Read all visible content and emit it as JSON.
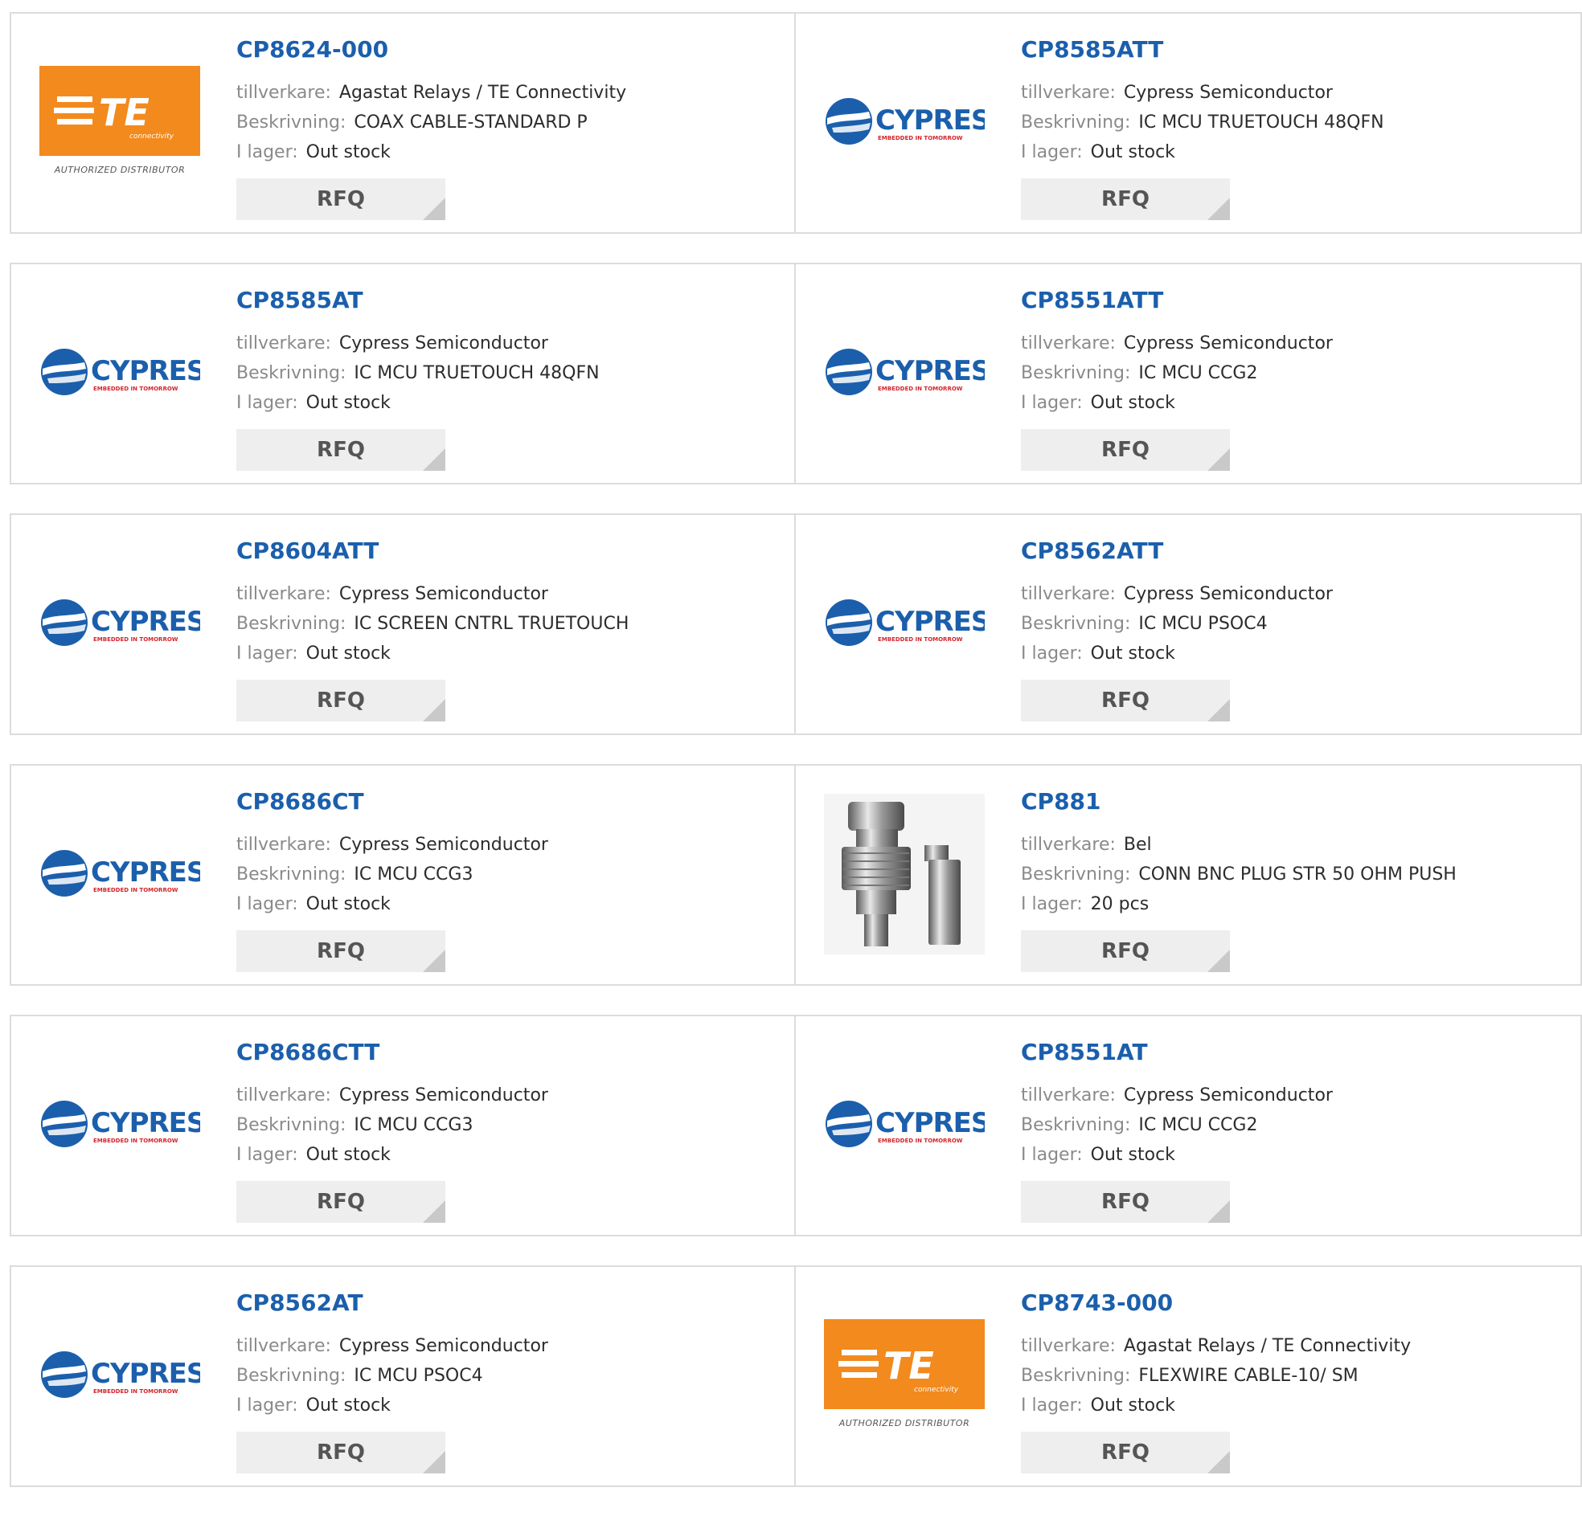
{
  "labels": {
    "manufacturer": "tillverkare:",
    "description": "Beskrivning:",
    "stock": "I lager:",
    "rfq": "RFQ"
  },
  "logos": {
    "te_letters": "TE",
    "te_sub": "connectivity",
    "te_distributor": "AUTHORIZED DISTRIBUTOR",
    "cypress_name": "CYPRESS",
    "cypress_tagline": "EMBEDDED IN TOMORROW"
  },
  "colors": {
    "part_link": "#1b5fac",
    "te_orange": "#f28a1e",
    "cypress_blue": "#1b5fac",
    "cypress_red": "#d4252b"
  },
  "products": [
    {
      "part": "CP8624-000",
      "manufacturer": "Agastat Relays / TE Connectivity",
      "description": "COAX CABLE-STANDARD P",
      "stock": "Out stock",
      "logo": "te-logo"
    },
    {
      "part": "CP8585ATT",
      "manufacturer": "Cypress Semiconductor",
      "description": "IC MCU TRUETOUCH 48QFN",
      "stock": "Out stock",
      "logo": "cypress-logo"
    },
    {
      "part": "CP8585AT",
      "manufacturer": "Cypress Semiconductor",
      "description": "IC MCU TRUETOUCH 48QFN",
      "stock": "Out stock",
      "logo": "cypress-logo"
    },
    {
      "part": "CP8551ATT",
      "manufacturer": "Cypress Semiconductor",
      "description": "IC MCU CCG2",
      "stock": "Out stock",
      "logo": "cypress-logo"
    },
    {
      "part": "CP8604ATT",
      "manufacturer": "Cypress Semiconductor",
      "description": "IC SCREEN CNTRL TRUETOUCH",
      "stock": "Out stock",
      "logo": "cypress-logo"
    },
    {
      "part": "CP8562ATT",
      "manufacturer": "Cypress Semiconductor",
      "description": "IC MCU PSOC4",
      "stock": "Out stock",
      "logo": "cypress-logo"
    },
    {
      "part": "CP8686CT",
      "manufacturer": "Cypress Semiconductor",
      "description": "IC MCU CCG3",
      "stock": "Out stock",
      "logo": "cypress-logo"
    },
    {
      "part": "CP881",
      "manufacturer": "Bel",
      "description": "CONN BNC PLUG STR 50 OHM PUSH",
      "stock": "20 pcs",
      "logo": "bnc-connector-image"
    },
    {
      "part": "CP8686CTT",
      "manufacturer": "Cypress Semiconductor",
      "description": "IC MCU CCG3",
      "stock": "Out stock",
      "logo": "cypress-logo"
    },
    {
      "part": "CP8551AT",
      "manufacturer": "Cypress Semiconductor",
      "description": "IC MCU CCG2",
      "stock": "Out stock",
      "logo": "cypress-logo"
    },
    {
      "part": "CP8562AT",
      "manufacturer": "Cypress Semiconductor",
      "description": "IC MCU PSOC4",
      "stock": "Out stock",
      "logo": "cypress-logo"
    },
    {
      "part": "CP8743-000",
      "manufacturer": "Agastat Relays / TE Connectivity",
      "description": "FLEXWIRE CABLE-10/ SM",
      "stock": "Out stock",
      "logo": "te-logo"
    }
  ]
}
